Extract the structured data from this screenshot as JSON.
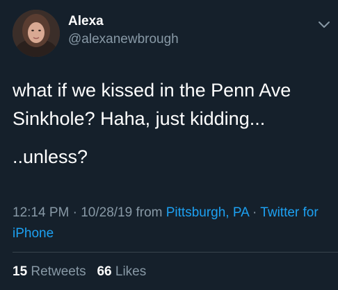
{
  "user": {
    "display_name": "Alexa",
    "handle": "@alexanewbrough"
  },
  "tweet": {
    "line1": "what if we kissed in the Penn Ave Sinkhole? Haha, just kidding...",
    "line2": " ..unless?"
  },
  "meta": {
    "time": "12:14 PM",
    "sep1": " · ",
    "date": "10/28/19",
    "from": " from ",
    "location": "Pittsburgh, PA",
    "sep2": " · ",
    "client": "Twitter for iPhone"
  },
  "stats": {
    "retweets_count": "15",
    "retweets_label": "Retweets",
    "likes_count": "66",
    "likes_label": "Likes"
  },
  "icons": {
    "menu": "chevron-down-icon"
  },
  "colors": {
    "background": "#15202b",
    "secondary_text": "#8899a6",
    "link": "#1da1f2",
    "divider": "#38444d"
  }
}
